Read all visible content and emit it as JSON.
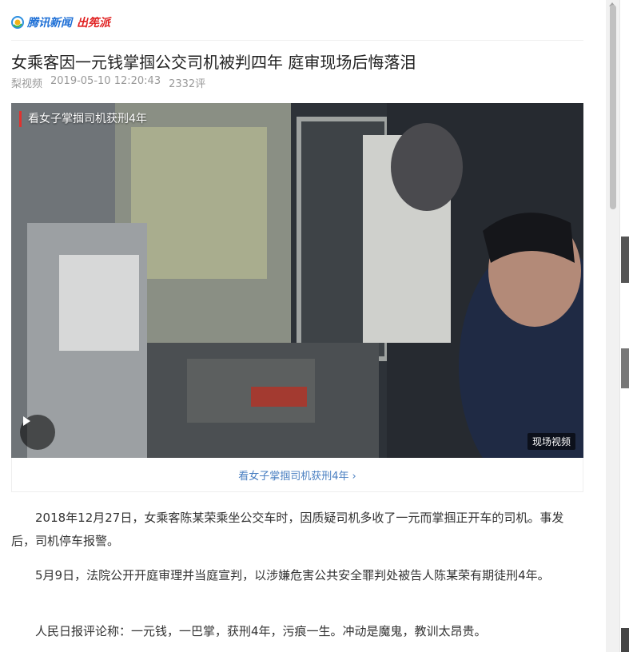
{
  "header": {
    "logo_text": "腾讯新闻",
    "logo_sub": "出筅派"
  },
  "article": {
    "title": "女乘客因一元钱掌掴公交司机被判四年 庭审现场后悔落泪",
    "source": "梨视频",
    "datetime": "2019-05-10 12:20:43",
    "comments": "2332评"
  },
  "video": {
    "title": "看女子掌掴司机获刑4年",
    "badge": "现场视频",
    "caption": "看女子掌掴司机获刑4年",
    "play_icon": "play-icon"
  },
  "body": {
    "p1": "2018年12月27日，女乘客陈某荣乘坐公交车时，因质疑司机多收了一元而掌掴正开车的司机。事发后，司机停车报警。",
    "p2": "5月9日，法院公开开庭审理并当庭宣判，以涉嫌危害公共安全罪判处被告人陈某荣有期徒刑4年。",
    "p3": "人民日报评论称：一元钱，一巴掌，获刑4年，污痕一生。冲动是魔鬼，教训太昂贵。"
  },
  "colors": {
    "link": "#4a7fc1",
    "accent": "#e0322e",
    "brand": "#1d6fd6"
  }
}
